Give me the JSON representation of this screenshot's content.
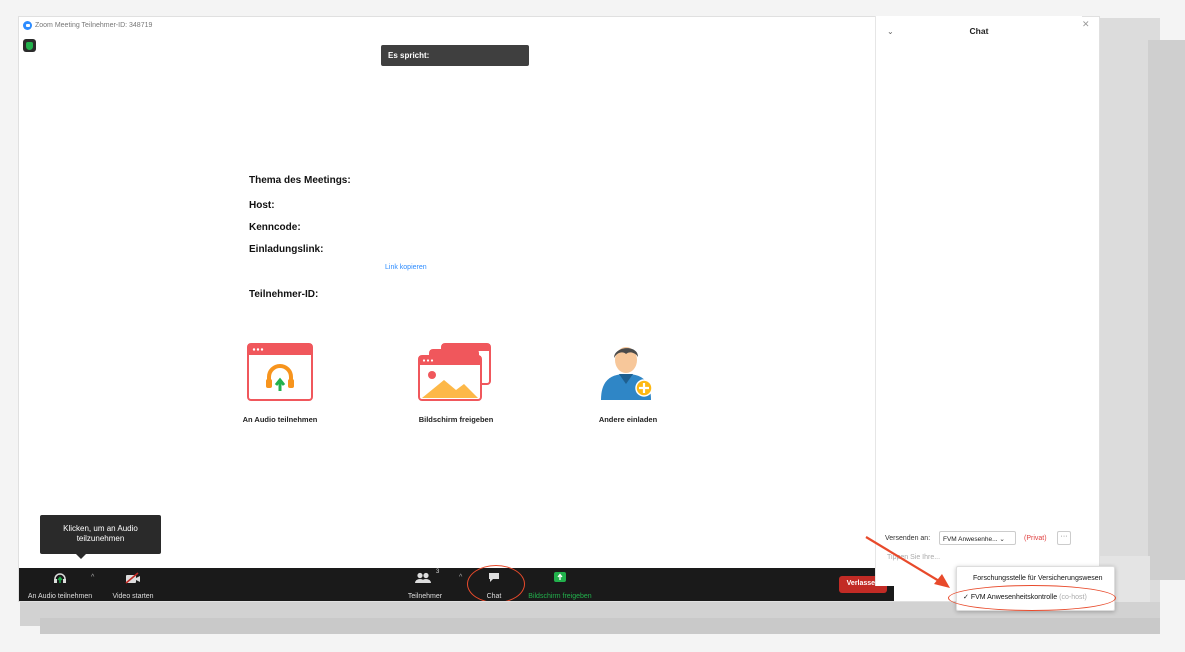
{
  "window": {
    "title": "Zoom Meeting Teilnehmer-ID: 348719",
    "controls": [
      "—",
      "☐",
      "✕"
    ]
  },
  "speaker_label": "Es spricht:",
  "meeting_info": {
    "topic_label": "Thema des Meetings:",
    "host_label": "Host:",
    "passcode_label": "Kenncode:",
    "invite_label": "Einladungslink:",
    "copy_link": "Link kopieren",
    "participant_id_label": "Teilnehmer-ID:"
  },
  "actions": [
    {
      "label": "An Audio teilnehmen",
      "icon": "headphones-icon"
    },
    {
      "label": "Bildschirm freigeben",
      "icon": "share-screen-icon"
    },
    {
      "label": "Andere einladen",
      "icon": "invite-person-icon"
    }
  ],
  "tooltip": {
    "line1": "Klicken, um an Audio",
    "line2": "teilzunehmen"
  },
  "toolbar": {
    "audio": "An Audio teilnehmen",
    "video": "Video starten",
    "participants": "Teilnehmer",
    "participants_count": "3",
    "chat": "Chat",
    "share": "Bildschirm freigeben",
    "leave": "Verlassen"
  },
  "chat_panel": {
    "title": "Chat",
    "send_to_label": "Versenden an:",
    "recipient": "FVM Anwesenhe...",
    "private": "(Privat)",
    "more": "···",
    "type_hint": "Tippen Sie Ihre..."
  },
  "recipient_dropdown": {
    "items": [
      {
        "label": "Forschungsstelle für Versicherungswesen",
        "checked": false,
        "suffix": ""
      },
      {
        "label": "FVM Anwesenheitskontrolle",
        "checked": true,
        "suffix": "(co-host)"
      }
    ]
  },
  "colors": {
    "accent_blue": "#2d8cff",
    "share_green": "#22b14c",
    "leave_red": "#c22b25",
    "annotation_red": "#e84a2b"
  }
}
